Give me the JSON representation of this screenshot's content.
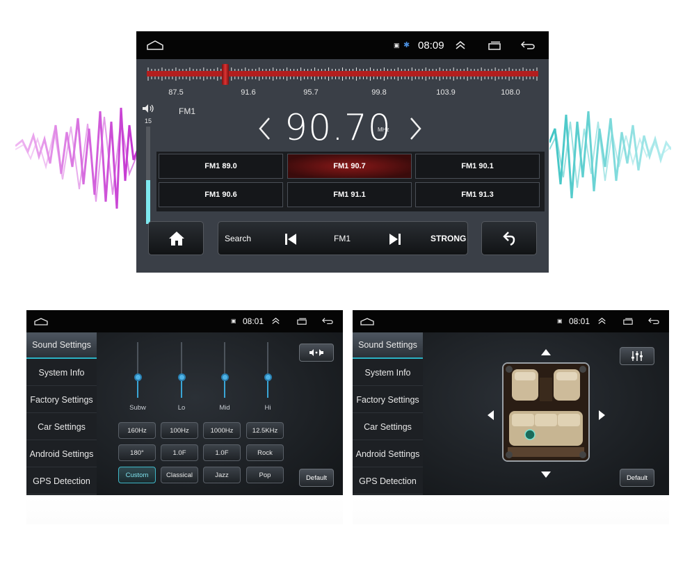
{
  "radio": {
    "time": "08:09",
    "scale_ticks": [
      "87.5",
      "91.6",
      "95.7",
      "99.8",
      "103.9",
      "108.0"
    ],
    "band": "FM1",
    "volume": "15",
    "volume_level": 0.45,
    "frequency": "90.70",
    "unit": "MHz",
    "tuner_position": 0.2,
    "presets": [
      {
        "label": "FM1 89.0",
        "active": false
      },
      {
        "label": "FM1 90.7",
        "active": true
      },
      {
        "label": "FM1 90.1",
        "active": false
      },
      {
        "label": "FM1 90.6",
        "active": false
      },
      {
        "label": "FM1 91.1",
        "active": false
      },
      {
        "label": "FM1 91.3",
        "active": false
      }
    ],
    "controls": {
      "search": "Search",
      "band": "FM1",
      "signal": "STRONG"
    }
  },
  "settings_eq": {
    "time": "08:01",
    "sidebar": [
      "Sound Settings",
      "System Info",
      "Factory Settings",
      "Car Settings",
      "Android Settings",
      "GPS Detection"
    ],
    "active_item": "Sound Settings",
    "sliders": [
      {
        "label": "Subw",
        "level": 0.5
      },
      {
        "label": "Lo",
        "level": 0.5
      },
      {
        "label": "Mid",
        "level": 0.5
      },
      {
        "label": "Hi",
        "level": 0.5
      }
    ],
    "freq_row": [
      "160Hz",
      "100Hz",
      "1000Hz",
      "12.5KHz"
    ],
    "phase_row": [
      "180°",
      "1.0F",
      "1.0F",
      "Rock"
    ],
    "preset_row": [
      "Custom",
      "Classical",
      "Jazz",
      "Pop"
    ],
    "selected_preset": "Custom",
    "default_label": "Default"
  },
  "settings_balance": {
    "time": "08:01",
    "sidebar": [
      "Sound Settings",
      "System Info",
      "Factory Settings",
      "Car Settings",
      "Android Settings",
      "GPS Detection"
    ],
    "active_item": "Sound Settings",
    "default_label": "Default"
  },
  "colors": {
    "accent": "#2bb3c5",
    "tuner_red": "#b31e1e",
    "wave_left": "#c43ad0",
    "wave_right": "#5fd6d0"
  }
}
